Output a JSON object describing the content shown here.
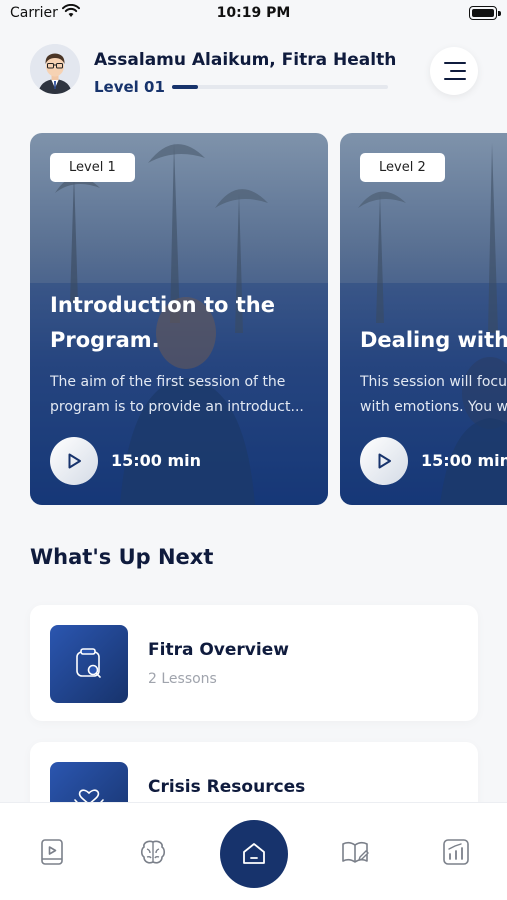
{
  "status_bar": {
    "carrier": "Carrier",
    "time": "10:19 PM"
  },
  "header": {
    "greeting": "Assalamu Alaikum, Fitra Health",
    "level_label": "Level 01",
    "level_progress": 0.12
  },
  "cards": [
    {
      "tag": "Level 1",
      "title": "Introduction to the Program.",
      "description_line1": "The aim of the first session of the",
      "description_line2": "program is to provide an introduct...",
      "duration": "15:00 min"
    },
    {
      "tag": "Level 2",
      "title": "Dealing with",
      "description_line1": "This session will focu",
      "description_line2": "with emotions. You w",
      "duration": "15:00 min"
    }
  ],
  "up_next": {
    "title": "What's Up Next",
    "items": [
      {
        "title": "Fitra Overview",
        "subtitle": "2 Lessons",
        "icon": "search-icon"
      },
      {
        "title": "Crisis Resources",
        "subtitle": "",
        "icon": "heart-hands-icon"
      }
    ]
  },
  "tab_bar": {
    "items": [
      "video-lesson-icon",
      "brain-icon",
      "home-icon",
      "journal-icon",
      "chart-icon"
    ],
    "active": "home-icon"
  },
  "colors": {
    "primary": "#17336c",
    "text": "#0f1b3d",
    "background": "#f6f7f9"
  }
}
